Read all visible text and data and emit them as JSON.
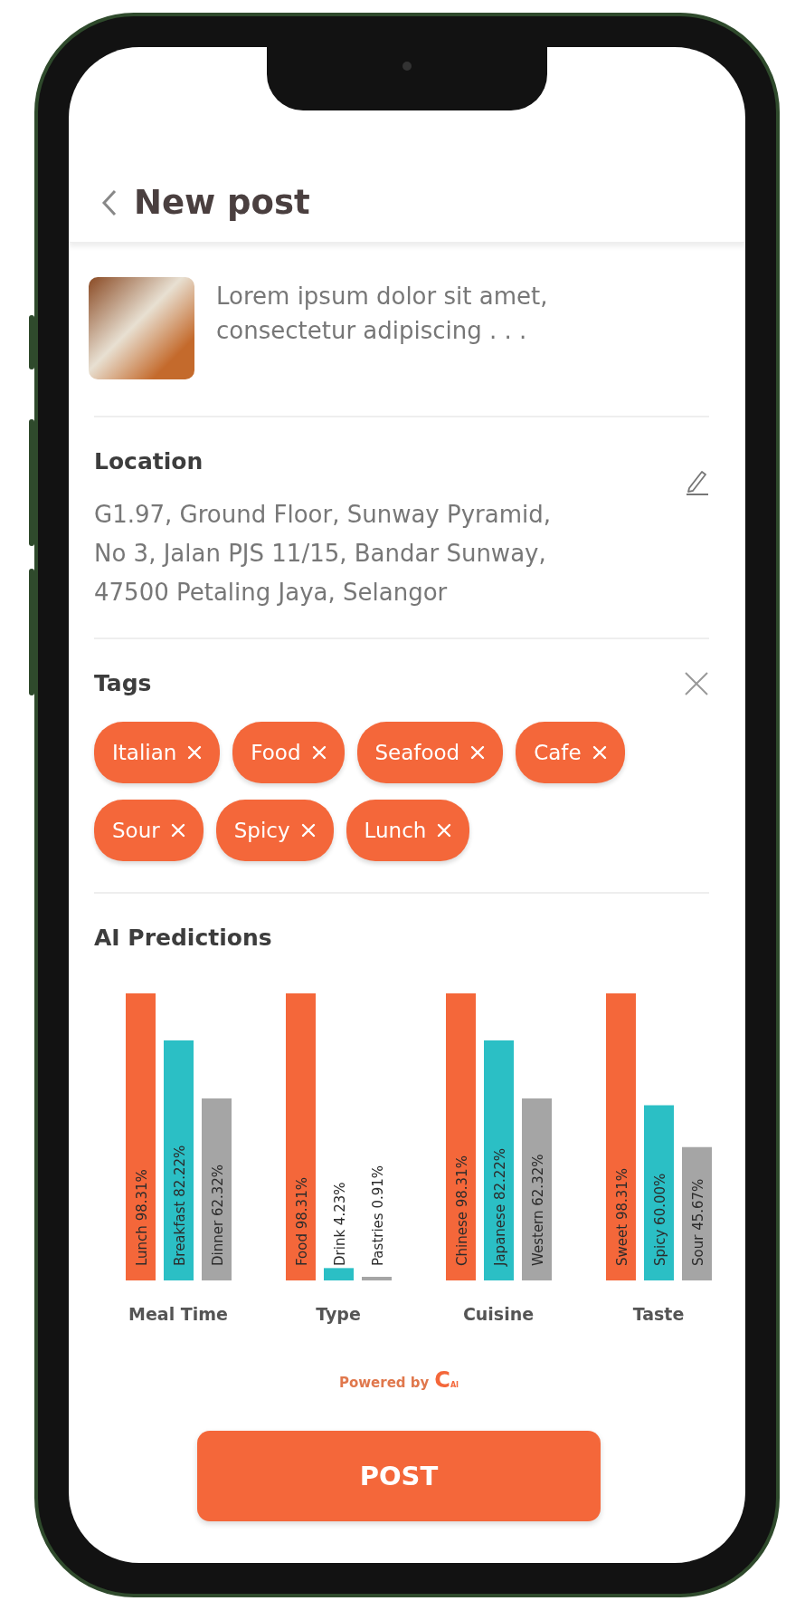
{
  "header": {
    "title": "New post"
  },
  "post": {
    "caption": "Lorem ipsum dolor sit amet, consectetur adipiscing . . ."
  },
  "location": {
    "heading": "Location",
    "address_lines": [
      "G1.97, Ground Floor, Sunway Pyramid,",
      "No 3, Jalan PJS 11/15, Bandar Sunway,",
      "47500 Petaling Jaya, Selangor"
    ]
  },
  "tags": {
    "heading": "Tags",
    "items": [
      "Italian",
      "Food",
      "Seafood",
      "Cafe",
      "Sour",
      "Spicy",
      "Lunch"
    ]
  },
  "predictions": {
    "heading": "AI Predictions",
    "chart_data": {
      "type": "bar",
      "categories": [
        "Meal Time",
        "Type",
        "Cuisine",
        "Taste"
      ],
      "series": [
        {
          "color": "#f4673a",
          "values": [
            98.31,
            98.31,
            98.31,
            98.31
          ],
          "value_labels": [
            "Lunch 98.31%",
            "Food 98.31%",
            "Chinese 98.31%",
            "Sweet 98.31%"
          ]
        },
        {
          "color": "#2bbfc5",
          "values": [
            82.22,
            4.23,
            82.22,
            60.0
          ],
          "value_labels": [
            "Breakfast 82.22%",
            "Drink 4.23%",
            "Japanese 82.22%",
            "Spicy 60.00%"
          ]
        },
        {
          "color": "#a5a5a5",
          "values": [
            62.32,
            0.91,
            62.32,
            45.67
          ],
          "value_labels": [
            "Dinner 62.32%",
            "Pastries 0.91%",
            "Western 62.32%",
            "Sour 45.67%"
          ]
        }
      ]
    }
  },
  "footer": {
    "powered_by": "Powered by",
    "logo_letter": "C",
    "logo_sub": "AI"
  },
  "post_button": "POST"
}
